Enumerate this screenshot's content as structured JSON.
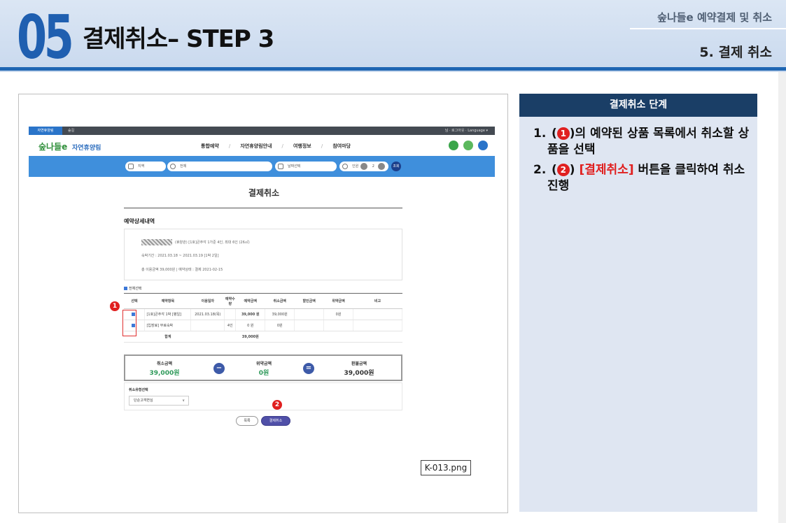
{
  "header": {
    "step_number": "05",
    "title": "결제취소– STEP 3",
    "breadcrumb_top": "숲나들e 예약결제 및 취소",
    "breadcrumb_bottom": "5. 결제 취소"
  },
  "screenshot": {
    "topbar": {
      "tab_active": "자연휴양림",
      "tab_other": "숲길",
      "right_text": "님 · 로그아웃 · Language ▾"
    },
    "nav": {
      "logo": "숲나들e",
      "site_name": "자연휴양림",
      "menu": [
        "통합예약",
        "자연휴양림안내",
        "여행정보",
        "참여마당"
      ]
    },
    "search": {
      "region": "지역",
      "forest": "전체",
      "date": "날짜선택",
      "people_label": "인원",
      "people_count": "2",
      "search_button": "조회"
    },
    "page_heading": "결제취소",
    "detail_title": "예약상세내역",
    "info": {
      "line1": "(휴양관) [1호]큰주각 1가준 4인, 최대 6인 (26㎡)",
      "line2": "숙박기간 : 2021.03.18 ~ 2021.03.19 [1박 2일]",
      "line3": "총 이용금액 39,000원 | 예약상태 : 결제 2021-02-15"
    },
    "select_all": "전체선택",
    "table": {
      "headers": [
        "선택",
        "예약항목",
        "이용일자",
        "예약수량",
        "예약금액",
        "취소금액",
        "할인금액",
        "위약금액",
        "비고"
      ],
      "rows": [
        [
          "",
          "[1호]큰주각 1박 [평일]",
          "2021.03.18(목)",
          "",
          "39,000 원",
          "39,000원",
          "",
          "0원",
          ""
        ],
        [
          "",
          "[입장료] 무료숙박",
          "",
          "4인",
          "0 원",
          "0원",
          "",
          "",
          ""
        ]
      ],
      "total_label": "합계",
      "total_value": "39,000원"
    },
    "calc": {
      "cancel_label": "취소금액",
      "cancel_value": "39,000원",
      "minus": "−",
      "penalty_label": "위약금액",
      "penalty_value": "0원",
      "equals": "=",
      "refund_label": "환불금액",
      "refund_value": "39,000원"
    },
    "cancel_type": {
      "label": "취소유형선택",
      "selected": "단순고객변심",
      "chevron": "∨"
    },
    "buttons": {
      "list": "목록",
      "pay_cancel": "결제취소"
    },
    "markers": {
      "one": "1",
      "two": "2"
    },
    "filename": "K-013.png"
  },
  "panel": {
    "title": "결제취소 단계",
    "step1_num": "1.",
    "step1_open": "(",
    "step1_marker": "1",
    "step1_text": ")의 예약된 상품 목록에서 취소할 상품을 선택",
    "step2_num": "2.",
    "step2_open": "(",
    "step2_marker": "2",
    "step2_close": ")",
    "step2_red": "[결제취소]",
    "step2_text": " 버튼을 클릭하여 취소 진행"
  },
  "colors": {
    "brand_blue": "#1f5fb0",
    "panel_head": "#1a3e66",
    "marker_red": "#e02020",
    "search_bar": "#3f8fdc"
  }
}
